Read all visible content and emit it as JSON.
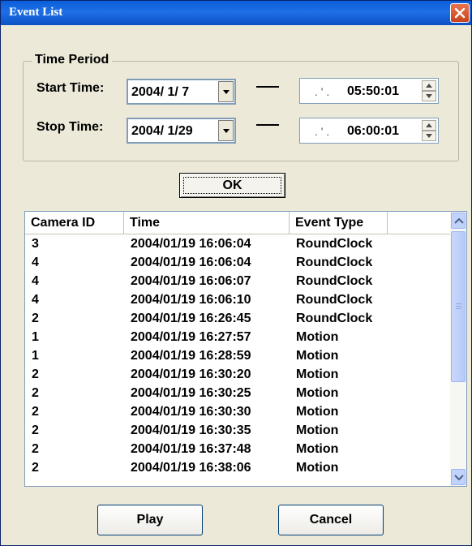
{
  "window": {
    "title": "Event List"
  },
  "time_period": {
    "legend": "Time Period",
    "start_label": "Start Time:",
    "stop_label": "Stop Time:",
    "start_date": "2004/ 1/ 7",
    "stop_date": "2004/ 1/29",
    "start_date_partial": ". ' .",
    "stop_date_partial": ". ' .",
    "start_time": "05:50:01",
    "stop_time": "06:00:01",
    "dash": "—"
  },
  "buttons": {
    "ok": "OK",
    "play": "Play",
    "cancel": "Cancel"
  },
  "list": {
    "columns": [
      "Camera ID",
      "Time",
      "Event Type"
    ],
    "rows": [
      {
        "camera": "3",
        "time": "2004/01/19 16:06:04",
        "type": "RoundClock"
      },
      {
        "camera": "4",
        "time": "2004/01/19 16:06:04",
        "type": "RoundClock"
      },
      {
        "camera": "4",
        "time": "2004/01/19 16:06:07",
        "type": "RoundClock"
      },
      {
        "camera": "4",
        "time": "2004/01/19 16:06:10",
        "type": "RoundClock"
      },
      {
        "camera": "2",
        "time": "2004/01/19 16:26:45",
        "type": "RoundClock"
      },
      {
        "camera": "1",
        "time": "2004/01/19 16:27:57",
        "type": "Motion"
      },
      {
        "camera": "1",
        "time": "2004/01/19 16:28:59",
        "type": "Motion"
      },
      {
        "camera": "2",
        "time": "2004/01/19 16:30:20",
        "type": "Motion"
      },
      {
        "camera": "2",
        "time": "2004/01/19 16:30:25",
        "type": "Motion"
      },
      {
        "camera": "2",
        "time": "2004/01/19 16:30:30",
        "type": "Motion"
      },
      {
        "camera": "2",
        "time": "2004/01/19 16:30:35",
        "type": "Motion"
      },
      {
        "camera": "2",
        "time": "2004/01/19 16:37:48",
        "type": "Motion"
      },
      {
        "camera": "2",
        "time": "2004/01/19 16:38:06",
        "type": "Motion"
      }
    ]
  },
  "icons": {
    "close": "close-icon",
    "dropdown": "chevron-down-icon",
    "spin_up": "chevron-up-icon",
    "spin_down": "chevron-down-icon",
    "scroll_up": "chevron-up-icon",
    "scroll_down": "chevron-down-icon"
  },
  "colors": {
    "titlebar": "#0a5fd8",
    "dialog_bg": "#ece9d8",
    "close_button": "#d9552c",
    "scrollbar": "#c2d3fb"
  }
}
